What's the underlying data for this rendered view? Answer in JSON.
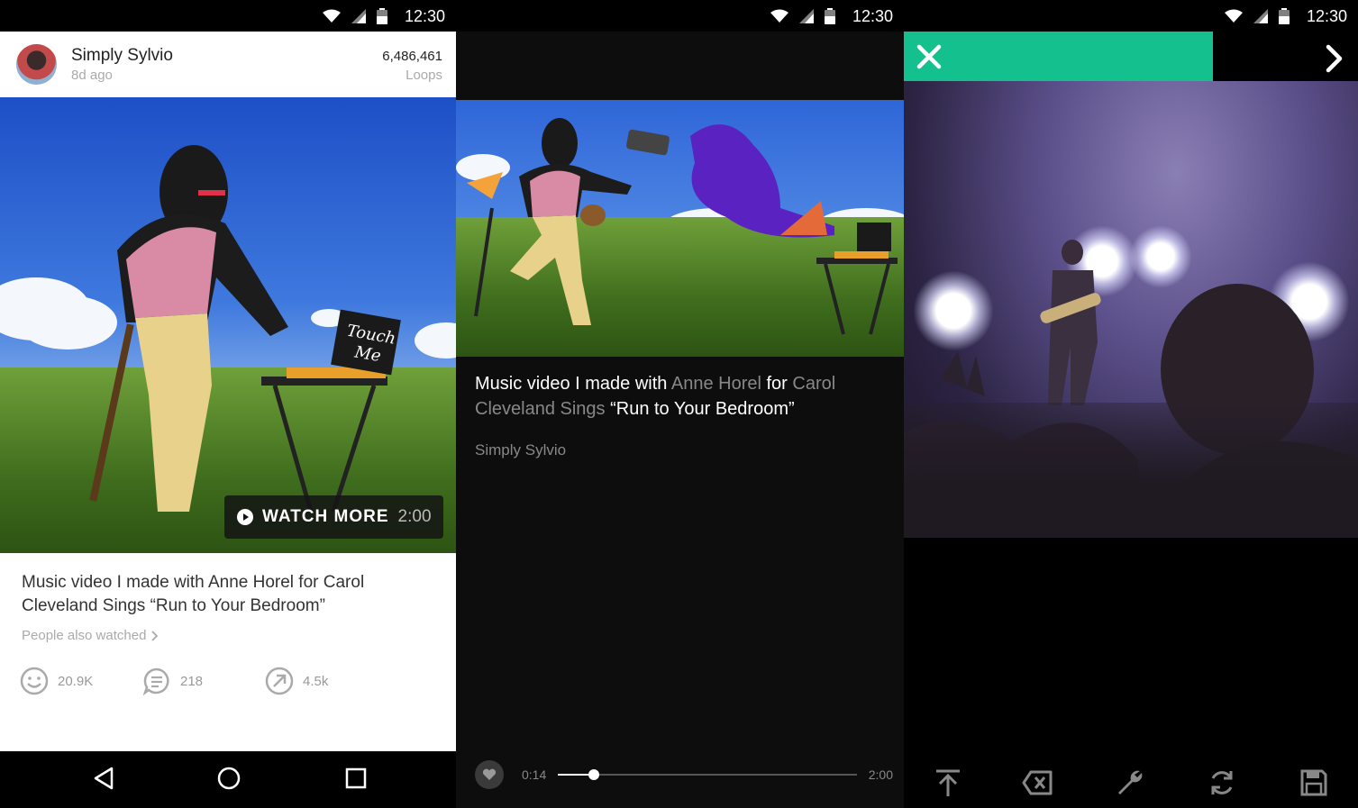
{
  "status_bar": {
    "time": "12:30"
  },
  "feed": {
    "author": "Simply Sylvio",
    "age": "8d ago",
    "loops_count": "6,486,461",
    "loops_label": "Loops",
    "video_sign": "Touch Me",
    "watch_more_label": "WATCH MORE",
    "watch_more_duration": "2:00",
    "caption": "Music video I made with Anne Horel for Carol Cleveland Sings “Run to Your Bedroom”",
    "people_also_watched": "People also watched",
    "stats": {
      "likes": "20.9K",
      "comments": "218",
      "revines": "4.5k"
    }
  },
  "player": {
    "caption_part1": "Music video I made with ",
    "caption_mention1": "Anne Horel",
    "caption_part2": " for ",
    "caption_mention2": "Carol Cleveland Sings",
    "caption_part3": " “Run to Your Bedroom”",
    "author": "Simply Sylvio",
    "current_time": "0:14",
    "total_time": "2:00",
    "progress_fraction": 0.12
  },
  "recorder": {
    "progress_fraction": 0.68,
    "accent_color": "#15c08f"
  },
  "icons": {
    "navigation": [
      "back-icon",
      "home-icon",
      "recents-icon"
    ],
    "stats": [
      "smile-icon",
      "comment-icon",
      "revine-icon"
    ],
    "recorder_tools": [
      "upload-icon",
      "delete-icon",
      "wrench-icon",
      "refresh-icon",
      "save-icon"
    ]
  }
}
